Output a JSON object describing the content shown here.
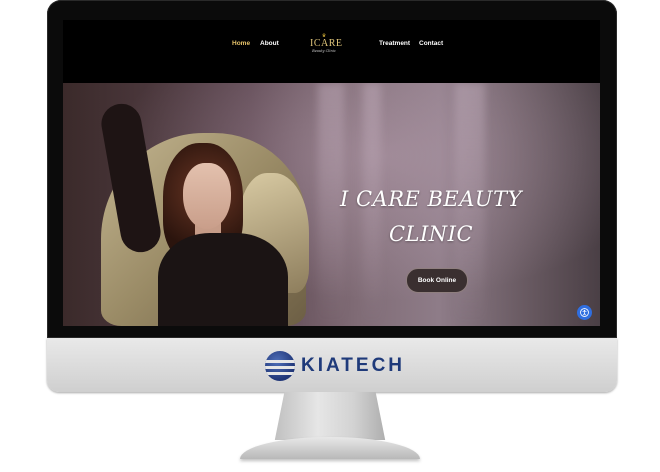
{
  "device": {
    "brand_name": "KIATECH"
  },
  "site": {
    "nav": {
      "items": [
        "Home",
        "About",
        "Treatment",
        "Contact"
      ],
      "active_index": 0
    },
    "logo": {
      "main": "ICARE",
      "sub": "Beauty Clinic"
    },
    "hero": {
      "title_line1": "I CARE BEAUTY",
      "title_line2": "CLINIC",
      "cta_label": "Book Online"
    },
    "colors": {
      "nav_active": "#e8c46a",
      "accessibility_button": "#2f6ee0"
    },
    "icons": {
      "accessibility": "accessibility-icon",
      "brand": "globe-logo-icon"
    }
  }
}
